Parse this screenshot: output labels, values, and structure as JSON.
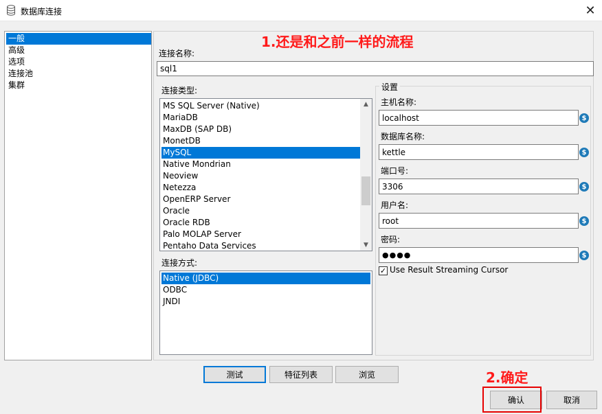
{
  "window": {
    "title": "数据库连接",
    "icon": "database-icon",
    "close_icon": "close-icon",
    "close_glyph": "✕"
  },
  "nav": {
    "items": [
      "一般",
      "高级",
      "选项",
      "连接池",
      "集群"
    ],
    "selected_index": 0
  },
  "annotations": {
    "step1": "1.还是和之前一样的流程",
    "step2": "2.确定",
    "color": "#ff1a1a"
  },
  "connection_name": {
    "label": "连接名称:",
    "value": "sql1"
  },
  "connection_type": {
    "label": "连接类型:",
    "items": [
      "MS SQL Server (Native)",
      "MariaDB",
      "MaxDB (SAP DB)",
      "MonetDB",
      "MySQL",
      "Native Mondrian",
      "Neoview",
      "Netezza",
      "OpenERP Server",
      "Oracle",
      "Oracle RDB",
      "Palo MOLAP Server",
      "Pentaho Data Services"
    ],
    "selected": "MySQL",
    "scroll_up_glyph": "▲",
    "scroll_down_glyph": "▼"
  },
  "access_method": {
    "label": "连接方式:",
    "items": [
      "Native (JDBC)",
      "ODBC",
      "JNDI"
    ],
    "selected": "Native (JDBC)"
  },
  "settings": {
    "title": "设置",
    "var_glyph": "$",
    "fields": [
      {
        "label": "主机名称:",
        "value": "localhost"
      },
      {
        "label": "数据库名称:",
        "value": "kettle"
      },
      {
        "label": "端口号:",
        "value": "3306"
      },
      {
        "label": "用户名:",
        "value": "root"
      },
      {
        "label": "密码:",
        "value": "●●●●"
      }
    ],
    "checkbox": {
      "label": "Use Result Streaming Cursor",
      "checked": true,
      "check_glyph": "✓"
    }
  },
  "buttons": {
    "test": "测试",
    "features": "特征列表",
    "explore": "浏览",
    "ok": "确认",
    "cancel": "取消"
  },
  "colors": {
    "selection": "#0078d7",
    "variable_icon": "#1e7ab8",
    "highlight_box": "#e60000"
  }
}
